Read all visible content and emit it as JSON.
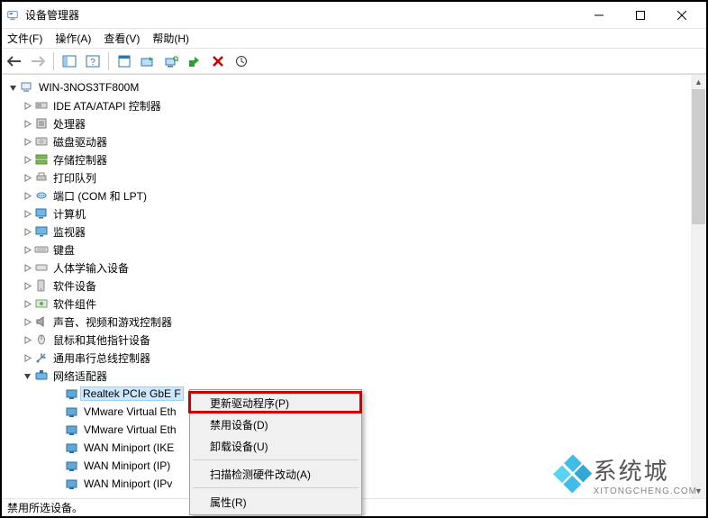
{
  "window": {
    "title": "设备管理器",
    "buttons": {
      "min": "minimize",
      "max": "maximize",
      "close": "close"
    }
  },
  "menu": {
    "file": "文件(F)",
    "action": "操作(A)",
    "view": "查看(V)",
    "help": "帮助(H)"
  },
  "tree": {
    "root": "WIN-3NOS3TF800M",
    "categories": [
      {
        "label": "IDE ATA/ATAPI 控制器",
        "icon": "ide"
      },
      {
        "label": "处理器",
        "icon": "cpu"
      },
      {
        "label": "磁盘驱动器",
        "icon": "disk"
      },
      {
        "label": "存储控制器",
        "icon": "storage"
      },
      {
        "label": "打印队列",
        "icon": "printer"
      },
      {
        "label": "端口 (COM 和 LPT)",
        "icon": "port"
      },
      {
        "label": "计算机",
        "icon": "computer"
      },
      {
        "label": "监视器",
        "icon": "monitor"
      },
      {
        "label": "键盘",
        "icon": "keyboard"
      },
      {
        "label": "人体学输入设备",
        "icon": "hid"
      },
      {
        "label": "软件设备",
        "icon": "software"
      },
      {
        "label": "软件组件",
        "icon": "component"
      },
      {
        "label": "声音、视频和游戏控制器",
        "icon": "sound"
      },
      {
        "label": "鼠标和其他指针设备",
        "icon": "mouse"
      },
      {
        "label": "通用串行总线控制器",
        "icon": "usb"
      }
    ],
    "network": {
      "label": "网络适配器",
      "children": [
        "Realtek PCIe GbE F",
        "VMware Virtual Eth",
        "VMware Virtual Eth",
        "WAN Miniport (IKE",
        "WAN Miniport (IP)",
        "WAN Miniport (IPv"
      ]
    }
  },
  "context_menu": {
    "items": [
      "更新驱动程序(P)",
      "禁用设备(D)",
      "卸载设备(U)",
      "__sep__",
      "扫描检测硬件改动(A)",
      "__sep__",
      "属性(R)"
    ]
  },
  "statusbar": {
    "text": "禁用所选设备。"
  },
  "watermark": {
    "big": "系统城",
    "small": "XITONGCHENG.COM"
  }
}
